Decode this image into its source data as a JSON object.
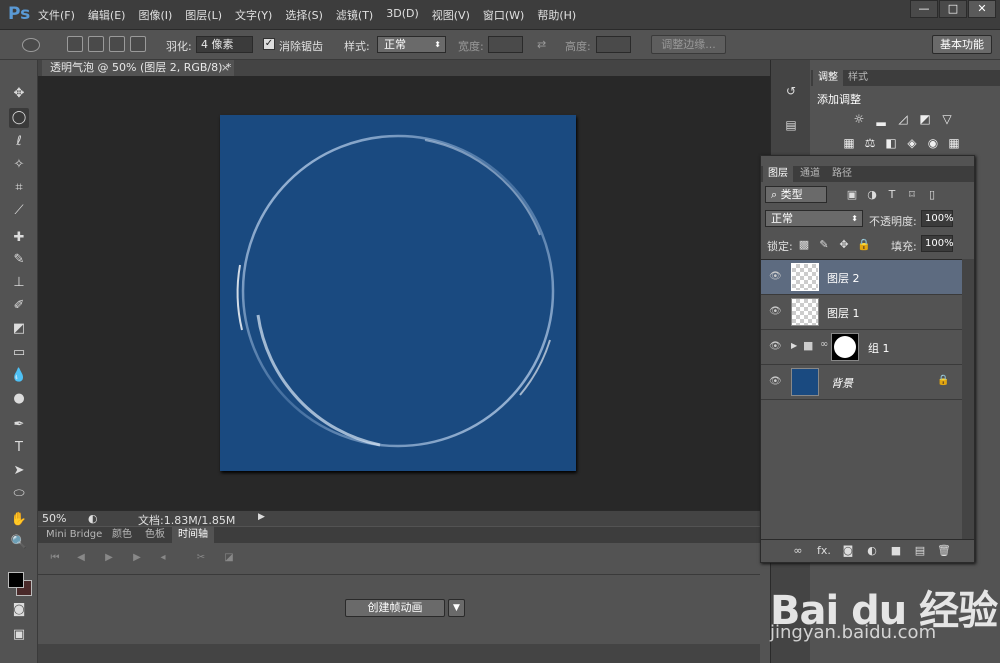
{
  "app": {
    "logo": "Ps"
  },
  "menu": [
    "文件(F)",
    "编辑(E)",
    "图像(I)",
    "图层(L)",
    "文字(Y)",
    "选择(S)",
    "滤镜(T)",
    "3D(D)",
    "视图(V)",
    "窗口(W)",
    "帮助(H)"
  ],
  "window_controls": {
    "minimize": "—",
    "maximize": "□",
    "close": "✕"
  },
  "options": {
    "feather_label": "羽化:",
    "feather_value": "4 像素",
    "antialias_label": "消除锯齿",
    "style_label": "样式:",
    "style_value": "正常",
    "width_label": "宽度:",
    "height_label": "高度:",
    "refine_edge": "调整边缘...",
    "workspace": "基本功能"
  },
  "document": {
    "tab_title": "透明气泡 @ 50% (图层 2, RGB/8) *",
    "tab_close": "×",
    "bg_color": "#1a4a80"
  },
  "status": {
    "zoom": "50%",
    "doc_size": "文档:1.83M/1.85M"
  },
  "bottom_panel": {
    "tabs": [
      "Mini Bridge",
      "颜色",
      "色板",
      "时间轴"
    ],
    "active_tab": "时间轴",
    "create_button": "创建帧动画"
  },
  "adjustments": {
    "tabs": [
      "调整",
      "样式"
    ],
    "title": "添加调整",
    "icons": [
      "brightness-icon",
      "levels-icon",
      "curves-icon",
      "exposure-icon",
      "vibrance-icon",
      "hue-sat-icon",
      "color-balance-icon",
      "bw-icon",
      "photo-filter-icon",
      "channel-mixer-icon",
      "color-lookup-icon"
    ]
  },
  "layers_panel": {
    "tabs": [
      "图层",
      "通道",
      "路径"
    ],
    "filter_type": "类型",
    "blend_mode": "正常",
    "opacity_label": "不透明度:",
    "opacity_value": "100%",
    "lock_label": "锁定:",
    "fill_label": "填充:",
    "fill_value": "100%",
    "layers": [
      {
        "name": "图层 2",
        "selected": true
      },
      {
        "name": "图层 1",
        "selected": false
      },
      {
        "name": "组 1",
        "selected": false
      },
      {
        "name": "背景",
        "selected": false
      }
    ],
    "footer_icons": [
      "link-icon",
      "fx-icon",
      "mask-icon",
      "adjustment-icon",
      "folder-icon",
      "new-layer-icon",
      "trash-icon"
    ],
    "footer_fx": "fx."
  },
  "watermark": {
    "logo": "Bai du 经验",
    "url": "jingyan.baidu.com"
  }
}
